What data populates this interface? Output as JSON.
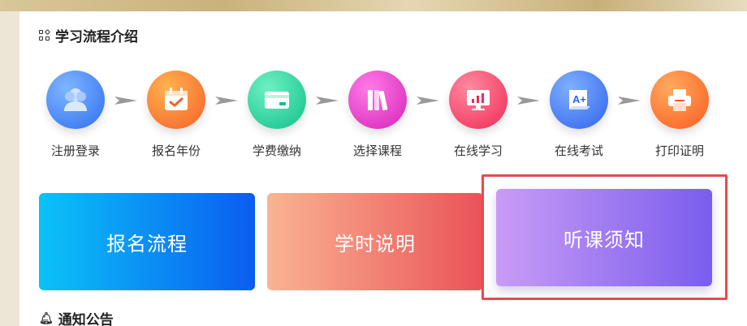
{
  "flow_section": {
    "title": "学习流程介绍"
  },
  "steps": [
    {
      "label": "注册登录",
      "icon": "user-icon",
      "color": "#3f86f4"
    },
    {
      "label": "报名年份",
      "icon": "calendar-check-icon",
      "color": "#f6792d"
    },
    {
      "label": "学费缴纳",
      "icon": "credit-card-icon",
      "color": "#17c590"
    },
    {
      "label": "选择课程",
      "icon": "books-icon",
      "color": "#e330c2"
    },
    {
      "label": "在线学习",
      "icon": "monitor-chart-icon",
      "color": "#f23b63"
    },
    {
      "label": "在线考试",
      "icon": "exam-icon",
      "color": "#3b72ef"
    },
    {
      "label": "打印证明",
      "icon": "printer-icon",
      "color": "#fb6d24"
    }
  ],
  "cards": [
    {
      "label": "报名流程"
    },
    {
      "label": "学时说明"
    },
    {
      "label": "听课须知"
    }
  ],
  "notice_section": {
    "title": "通知公告"
  }
}
